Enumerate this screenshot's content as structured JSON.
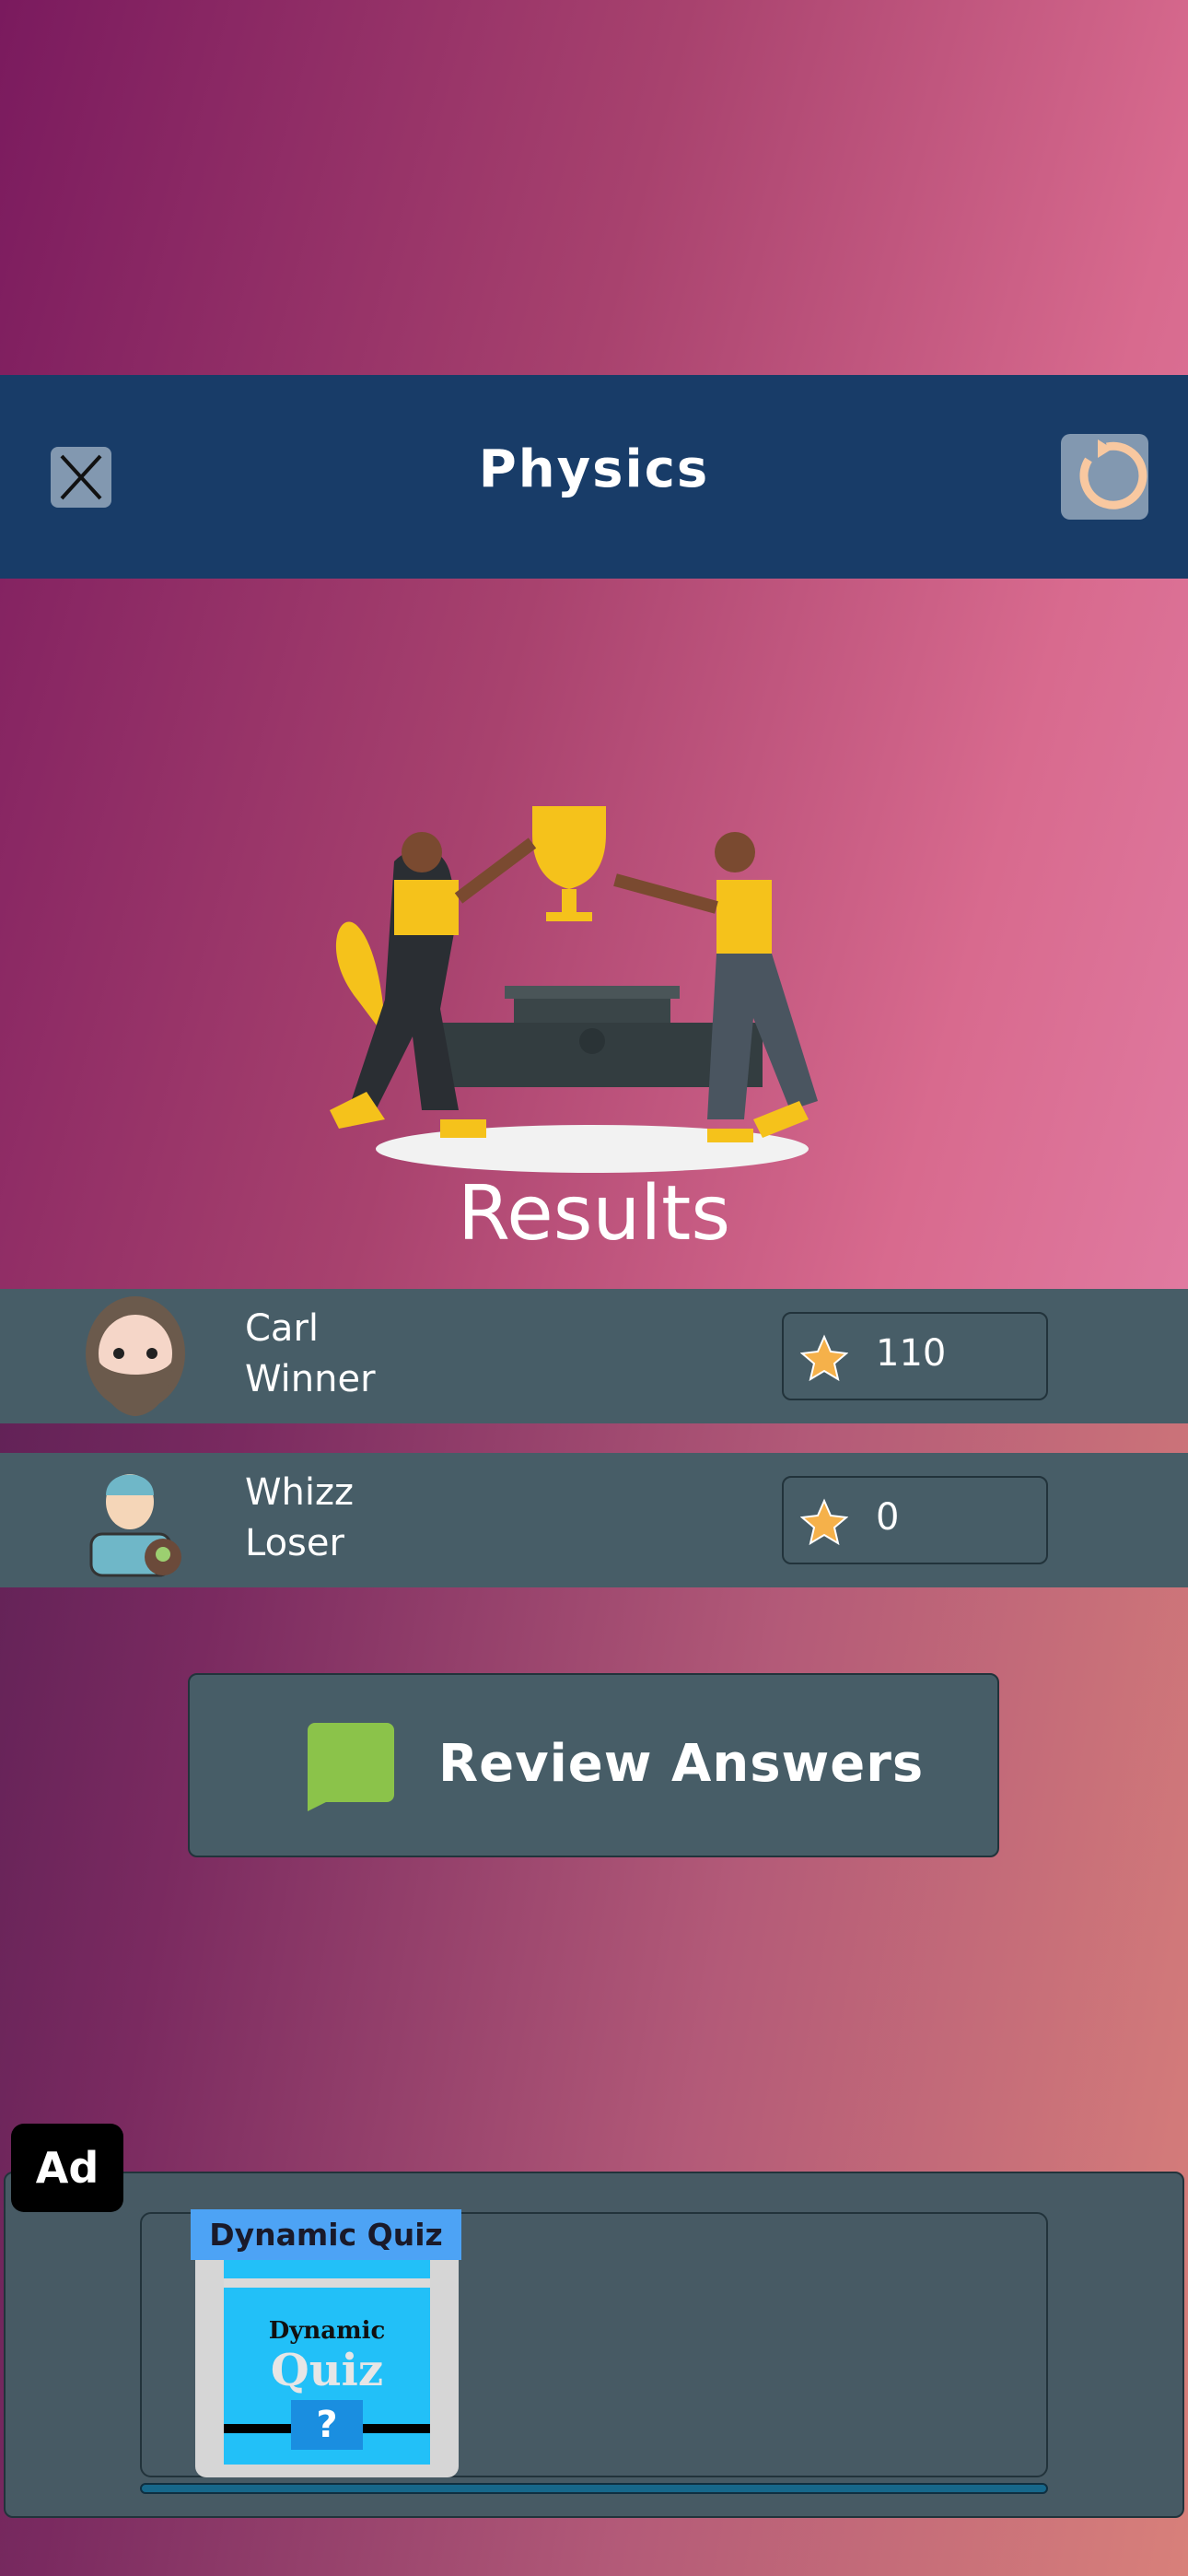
{
  "header": {
    "title": "Physics",
    "close_icon": "close-x-icon",
    "reload_icon": "reload-icon"
  },
  "results": {
    "title": "Results",
    "illustration": "trophy-celebration-illustration"
  },
  "players": [
    {
      "name": "Carl",
      "status": "Winner",
      "score": "110",
      "avatar": "bearded-man-avatar"
    },
    {
      "name": "Whizz",
      "status": "Loser",
      "score": "0",
      "avatar": "cap-boy-avatar"
    }
  ],
  "review": {
    "label": "Review Answers",
    "icon": "speech-bubble-icon",
    "icon_color": "#8bc34a"
  },
  "ad": {
    "badge": "Ad",
    "app_name": "Dynamic Quiz",
    "logo_line1": "Dynamic",
    "logo_line2": "Quiz",
    "logo_mark": "?"
  },
  "colors": {
    "header": "#183c68",
    "panel": "#475d67",
    "star": "#f5b14a",
    "reload": "#f8c8a0"
  }
}
